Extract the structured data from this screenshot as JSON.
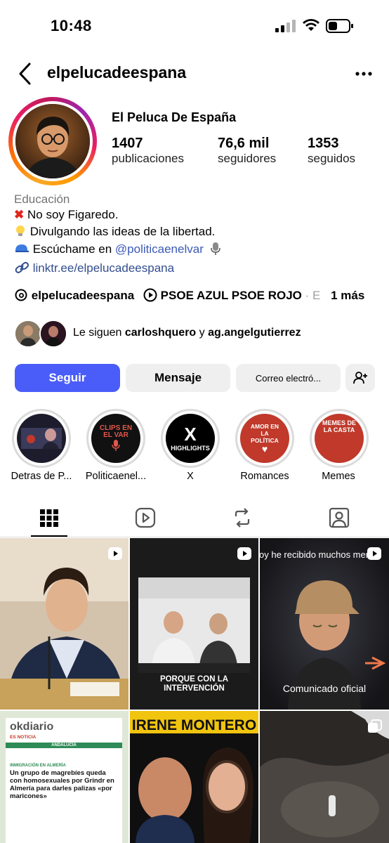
{
  "status": {
    "time": "10:48"
  },
  "header": {
    "username": "elpelucadeespana"
  },
  "profile": {
    "full_name": "El Peluca De España",
    "stats": [
      {
        "value": "1407",
        "label": "publicaciones"
      },
      {
        "value": "76,6 mil",
        "label": "seguidores"
      },
      {
        "value": "1353",
        "label": "seguidos"
      }
    ],
    "category": "Educación",
    "bio": {
      "line1": "No soy Figaredo.",
      "line2": "Divulgando las ideas de la libertad.",
      "line3_text": "Escúchame en ",
      "line3_mention": "@politicaenelvar",
      "link": "linktr.ee/elpelucadeespana"
    },
    "threads_handle": "elpelucadeespana",
    "music": "PSOE AZUL PSOE ROJO",
    "music_more": "· E",
    "more": "1 más",
    "followed_by": {
      "prefix": "Le siguen ",
      "user1": "carloshquero",
      "connector": " y ",
      "user2": "ag.angelgutierrez"
    }
  },
  "actions": {
    "follow": "Seguir",
    "message": "Mensaje",
    "email": "Correo electró..."
  },
  "highlights": [
    {
      "label": "Detras de P...",
      "art_text": ""
    },
    {
      "label": "Politicaenel...",
      "art_text": "CLIPS EN EL VAR"
    },
    {
      "label": "X",
      "art_text": "HIGHLIGHTS"
    },
    {
      "label": "Romances",
      "art_text": "AMOR EN LA POLÍTICA"
    },
    {
      "label": "Memes",
      "art_text": "MEMES DE LA CASTA"
    }
  ],
  "posts": {
    "p2_caption": "PORQUE CON LA INTERVENCIÓN",
    "p3_top": "oy he recibido muchos men",
    "p3_caption": "Comunicado oficial",
    "p4_brand": "okdiario",
    "p4_section": "ES NOTICIA",
    "p4_sub": "ANDALUCÍA",
    "p4_kicker": "INMIGRACIÓN EN ALMERÍA",
    "p4_headline": "Un grupo de magrebíes queda con homosexuales por Grindr en Almería para darles palizas «por maricones»",
    "p5_title": "IRENE MONTERO"
  },
  "colors": {
    "accent": "#4a5df9",
    "link": "#324d8f"
  }
}
